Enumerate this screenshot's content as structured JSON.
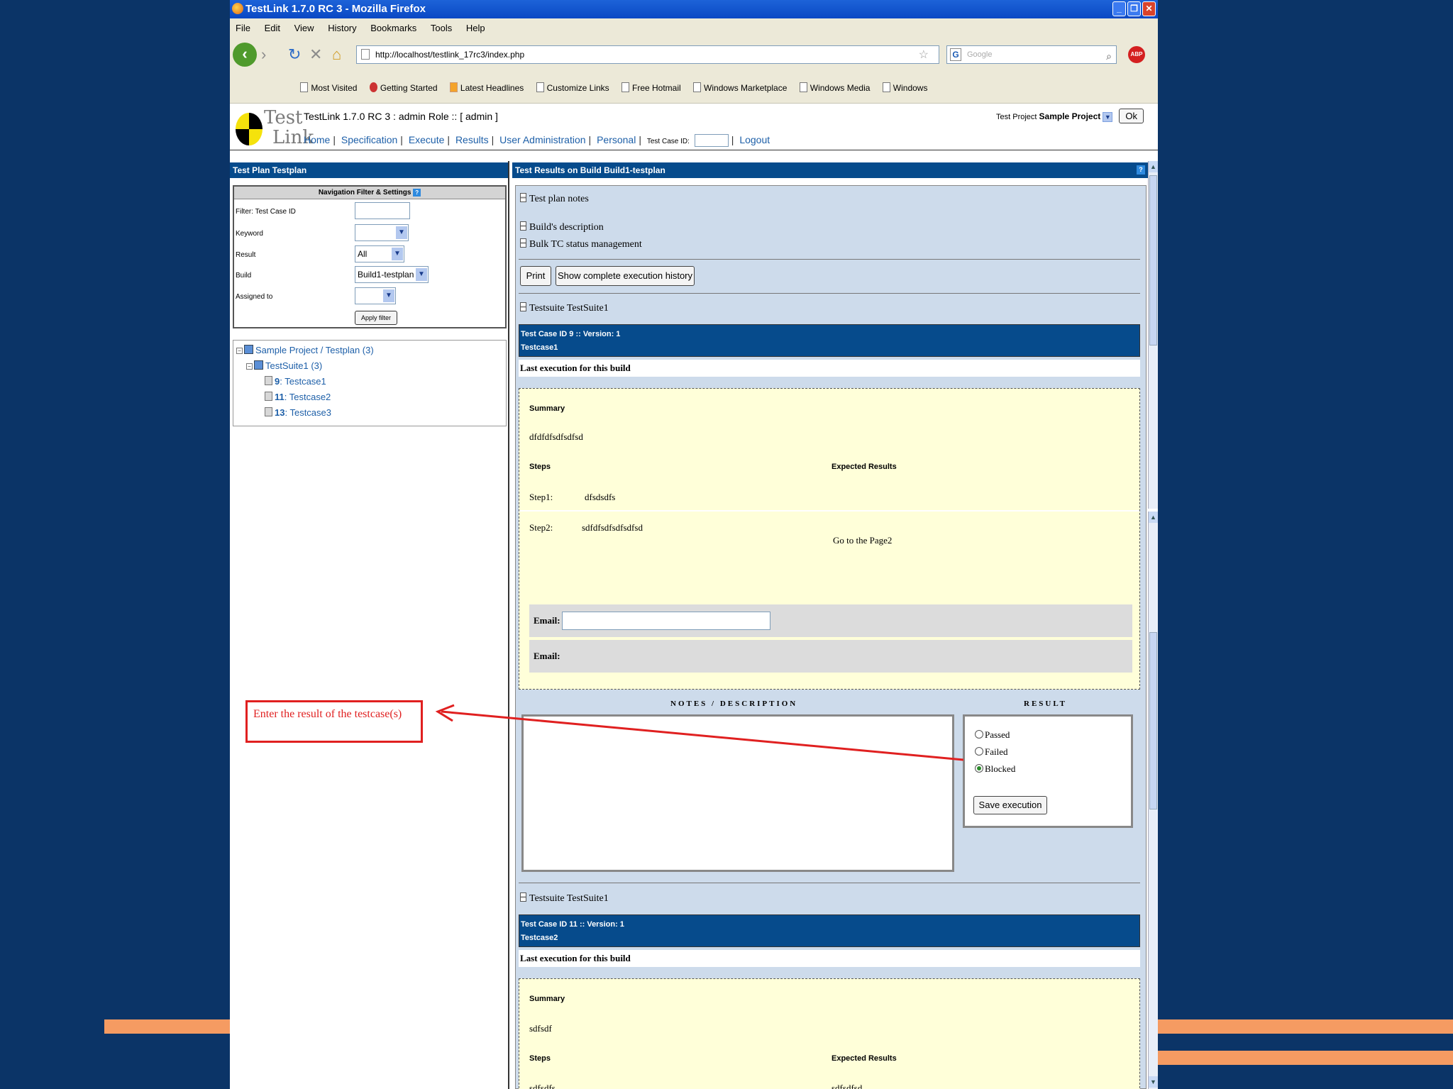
{
  "window": {
    "title": "TestLink 1.7.0 RC 3 - Mozilla Firefox"
  },
  "menu": [
    "File",
    "Edit",
    "View",
    "History",
    "Bookmarks",
    "Tools",
    "Help"
  ],
  "url": "http://localhost/testlink_17rc3/index.php",
  "search_placeholder": "Google",
  "bookmarks": [
    "Most Visited",
    "Getting Started",
    "Latest Headlines",
    "Customize Links",
    "Free Hotmail",
    "Windows Marketplace",
    "Windows Media",
    "Windows"
  ],
  "header": {
    "logo_text_top": "Test",
    "logo_text_bottom": "Link",
    "app_title": "TestLink 1.7.0 RC 3 : admin Role :: [ admin ]",
    "project_label": "Test Project",
    "project_value": "Sample Project",
    "ok": "Ok",
    "nav": [
      "Home",
      "Specification",
      "Execute",
      "Results",
      "User Administration",
      "Personal"
    ],
    "tcid_label": "Test Case ID:",
    "logout": "Logout"
  },
  "left": {
    "title": "Test Plan Testplan",
    "filter_title": "Navigation Filter & Settings",
    "filter_help": "?",
    "filters": [
      {
        "label": "Filter: Test Case ID",
        "value": ""
      },
      {
        "label": "Keyword",
        "value": ""
      },
      {
        "label": "Result",
        "value": "All"
      },
      {
        "label": "Build",
        "value": "Build1-testplan"
      },
      {
        "label": "Assigned to",
        "value": ""
      }
    ],
    "apply": "Apply filter",
    "tree": {
      "root": "Sample Project / Testplan (3)",
      "suite": "TestSuite1 (3)",
      "cases": [
        {
          "id": "9",
          "name": "Testcase1"
        },
        {
          "id": "11",
          "name": "Testcase2"
        },
        {
          "id": "13",
          "name": "Testcase3"
        }
      ]
    }
  },
  "right": {
    "title": "Test Results on Build Build1-testplan",
    "help": "?",
    "sections": [
      "Test plan notes",
      "Build's description",
      "Bulk TC status management"
    ],
    "print": "Print",
    "history": "Show complete execution history",
    "tc1": {
      "suite": "Testsuite TestSuite1",
      "bar_line1": "Test Case ID 9 :: Version: 1",
      "bar_line2": "Testcase1",
      "last_exec": "Last execution for this build",
      "summary_label": "Summary",
      "summary": "dfdfdfsdfsdfsd",
      "steps_label": "Steps",
      "expected_label": "Expected Results",
      "step1_label": "Step1:",
      "step1": "dfsdsdfs",
      "step2_label": "Step2:",
      "step2": "sdfdfsdfsdfsdfsd",
      "expected2": "Go to the Page2",
      "email1": "Email:",
      "email2": "Email:"
    },
    "notes_label": "Notes / Description",
    "result_label": "Result",
    "results": [
      "Passed",
      "Failed",
      "Blocked"
    ],
    "selected_result": "Blocked",
    "save": "Save execution",
    "tc2": {
      "suite": "Testsuite TestSuite1",
      "bar_line1": "Test Case ID 11 :: Version: 1",
      "bar_line2": "Testcase2",
      "last_exec": "Last execution for this build",
      "summary_label": "Summary",
      "summary": "sdfsdf",
      "steps_label": "Steps",
      "expected_label": "Expected Results",
      "step_cut": "sdfsdfs",
      "expected_cut": "sdfsdfsd"
    }
  },
  "callout": "Enter the result of the testcase(s)",
  "colors": {
    "slide_bg": "#0b3467",
    "stripe": "#f59b62",
    "header_blue": "#064b8c",
    "callout": "#e02020",
    "yellow_panel": "#ffffd9"
  }
}
